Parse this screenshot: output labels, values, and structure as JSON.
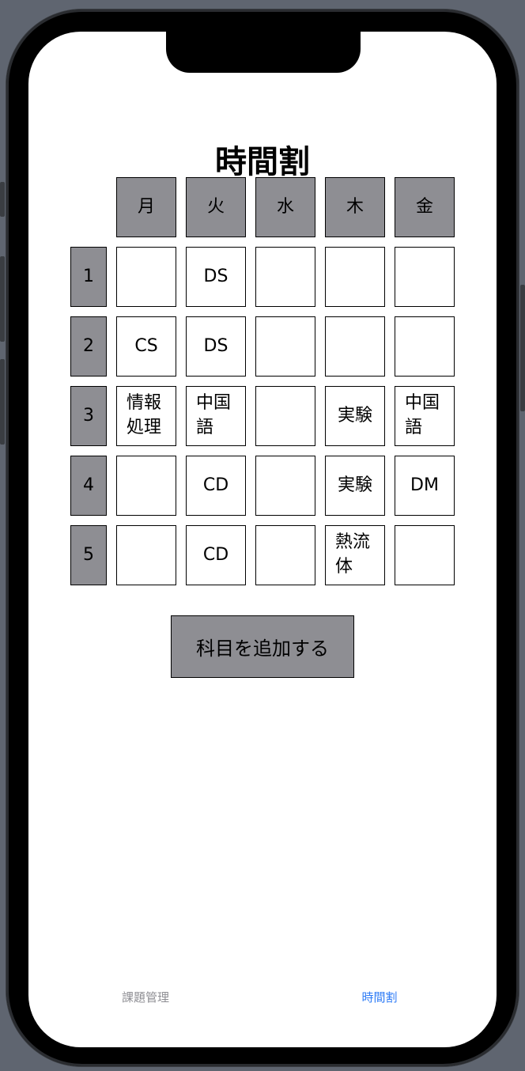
{
  "title": "時間割",
  "days": [
    "月",
    "火",
    "水",
    "木",
    "金"
  ],
  "periods": [
    "1",
    "2",
    "3",
    "4",
    "5"
  ],
  "grid": [
    [
      "",
      "DS",
      "",
      "",
      ""
    ],
    [
      "CS",
      "DS",
      "",
      "",
      ""
    ],
    [
      "情報\n処理",
      "中国\n語",
      "",
      "実験",
      "中国\n語"
    ],
    [
      "",
      "CD",
      "",
      "実験",
      "DM"
    ],
    [
      "",
      "CD",
      "",
      "熱流\n体",
      ""
    ]
  ],
  "add_button_label": "科目を追加する",
  "tabs": [
    {
      "label": "課題管理",
      "active": false
    },
    {
      "label": "時間割",
      "active": true
    }
  ],
  "colors": {
    "header_gray": "#8e8e93",
    "tab_active": "#2f7cf6",
    "tab_inactive": "#8e8e93"
  }
}
